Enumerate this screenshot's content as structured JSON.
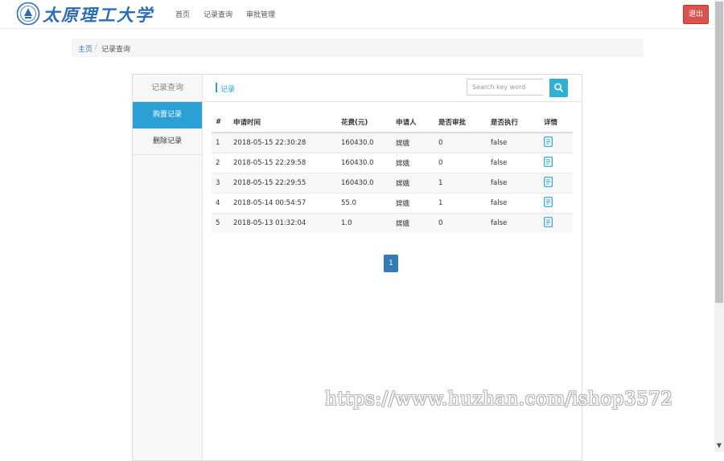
{
  "header": {
    "logo_text": "太原理工大学",
    "nav": [
      "首页",
      "记录查询",
      "审批管理"
    ],
    "logout_label": "退出"
  },
  "breadcrumb": {
    "home": "主页",
    "separator": "/",
    "current": "记录查询"
  },
  "sidebar": {
    "title": "记录查询",
    "items": [
      {
        "label": "购置记录",
        "active": true
      },
      {
        "label": "删除记录",
        "active": false
      }
    ]
  },
  "content": {
    "title": "记录",
    "search_placeholder": "Search key word",
    "search_icon": "search-icon",
    "detail_icon": "document-icon"
  },
  "table": {
    "columns": [
      "#",
      "申请时间",
      "花费(元)",
      "申请人",
      "是否审批",
      "是否执行",
      "详情"
    ],
    "rows": [
      {
        "no": "1",
        "time": "2018-05-15 22:30:28",
        "cost": "160430.0",
        "applicant": "嫦娥",
        "approved": "0",
        "executed": "false"
      },
      {
        "no": "2",
        "time": "2018-05-15 22:29:58",
        "cost": "160430.0",
        "applicant": "嫦娥",
        "approved": "0",
        "executed": "false"
      },
      {
        "no": "3",
        "time": "2018-05-15 22:29:55",
        "cost": "160430.0",
        "applicant": "嫦娥",
        "approved": "1",
        "executed": "false"
      },
      {
        "no": "4",
        "time": "2018-05-14 00:54:57",
        "cost": "55.0",
        "applicant": "嫦娥",
        "approved": "1",
        "executed": "false"
      },
      {
        "no": "5",
        "time": "2018-05-13 01:32:04",
        "cost": "1.0",
        "applicant": "嫦娥",
        "approved": "0",
        "executed": "false"
      }
    ]
  },
  "pagination": {
    "current_page": "1"
  },
  "watermark": "https://www.huzhan.com/ishop3572",
  "colors": {
    "accent": "#2aa0d4",
    "logout": "#d9534f",
    "page": "#337ab7",
    "logo": "#2b6cb3"
  }
}
